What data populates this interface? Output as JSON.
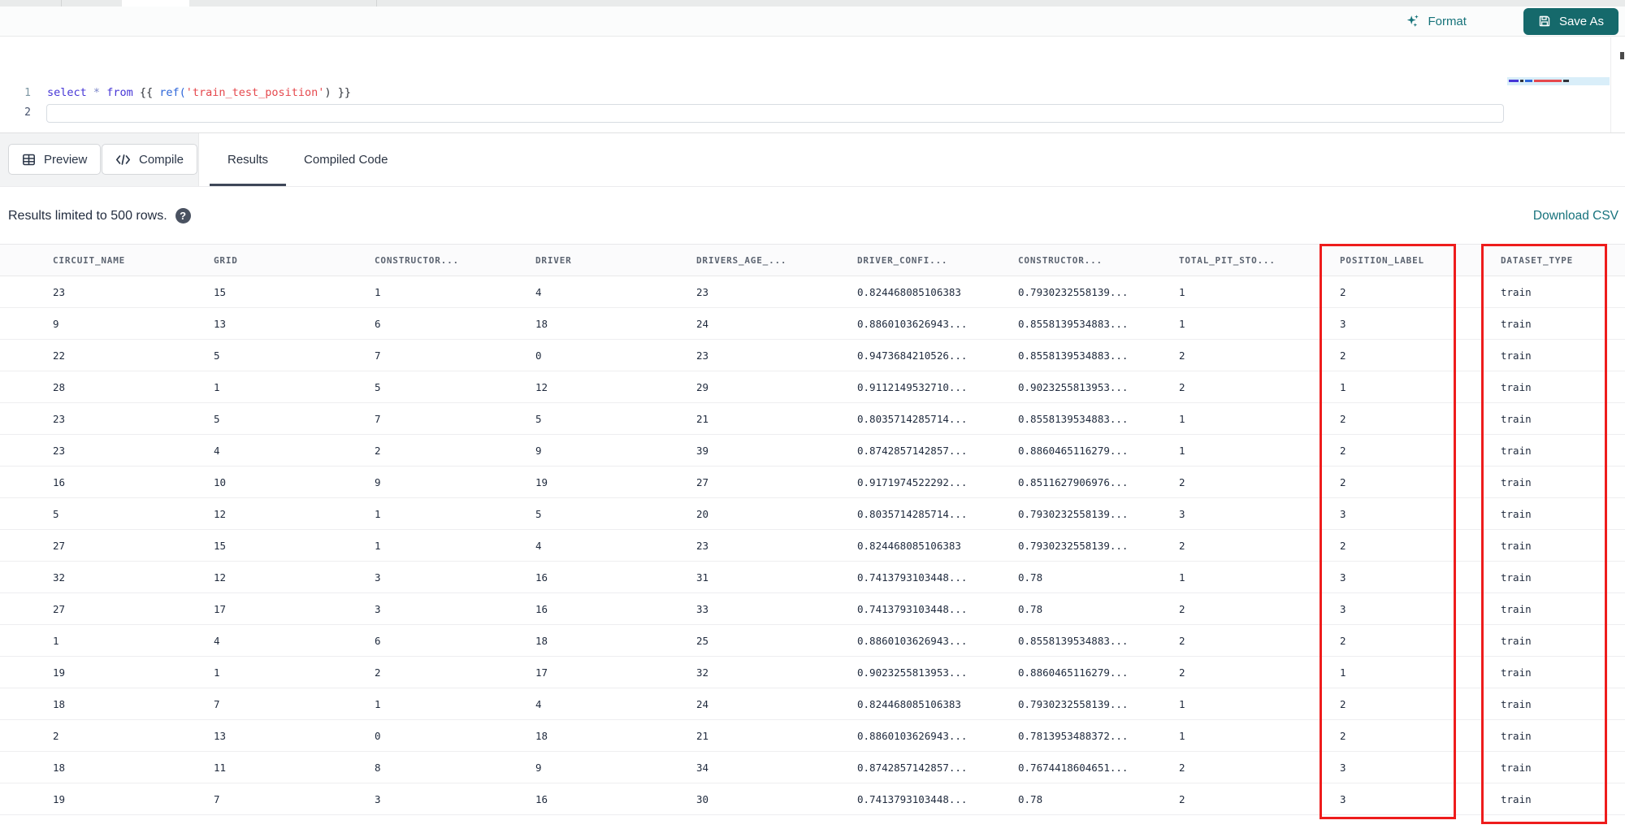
{
  "topbar": {
    "format_label": "Format",
    "save_as_label": "Save As"
  },
  "editor": {
    "line_numbers": [
      "1",
      "2"
    ],
    "code_text": "select * from {{ ref('train_test_position') }}",
    "code_tokens": [
      {
        "text": "select",
        "type": "keyword"
      },
      {
        "text": " ",
        "type": "brace"
      },
      {
        "text": "*",
        "type": "operator"
      },
      {
        "text": " ",
        "type": "brace"
      },
      {
        "text": "from",
        "type": "keyword"
      },
      {
        "text": " {{ ",
        "type": "brace"
      },
      {
        "text": "ref(",
        "type": "function"
      },
      {
        "text": "'train_test_position'",
        "type": "string"
      },
      {
        "text": ")",
        "type": "brace"
      },
      {
        "text": " }}",
        "type": "brace"
      }
    ]
  },
  "actionbar": {
    "preview_label": "Preview",
    "compile_label": "Compile",
    "tabs": [
      {
        "label": "Results",
        "active": true
      },
      {
        "label": "Compiled Code",
        "active": false
      }
    ]
  },
  "results": {
    "limit_note": "Results limited to 500 rows.",
    "help_glyph": "?",
    "download_label": "Download CSV",
    "table": {
      "columns": [
        "CIRCUIT_NAME",
        "GRID",
        "CONSTRUCTOR...",
        "DRIVER",
        "DRIVERS_AGE_...",
        "DRIVER_CONFI...",
        "CONSTRUCTOR...",
        "TOTAL_PIT_STO...",
        "POSITION_LABEL",
        "DATASET_TYPE"
      ],
      "rows": [
        [
          "23",
          "15",
          "1",
          "4",
          "23",
          "0.824468085106383",
          "0.7930232558139...",
          "1",
          "2",
          "train"
        ],
        [
          "9",
          "13",
          "6",
          "18",
          "24",
          "0.8860103626943...",
          "0.8558139534883...",
          "1",
          "3",
          "train"
        ],
        [
          "22",
          "5",
          "7",
          "0",
          "23",
          "0.9473684210526...",
          "0.8558139534883...",
          "2",
          "2",
          "train"
        ],
        [
          "28",
          "1",
          "5",
          "12",
          "29",
          "0.9112149532710...",
          "0.9023255813953...",
          "2",
          "1",
          "train"
        ],
        [
          "23",
          "5",
          "7",
          "5",
          "21",
          "0.8035714285714...",
          "0.8558139534883...",
          "1",
          "2",
          "train"
        ],
        [
          "23",
          "4",
          "2",
          "9",
          "39",
          "0.8742857142857...",
          "0.8860465116279...",
          "1",
          "2",
          "train"
        ],
        [
          "16",
          "10",
          "9",
          "19",
          "27",
          "0.9171974522292...",
          "0.8511627906976...",
          "2",
          "2",
          "train"
        ],
        [
          "5",
          "12",
          "1",
          "5",
          "20",
          "0.8035714285714...",
          "0.7930232558139...",
          "3",
          "3",
          "train"
        ],
        [
          "27",
          "15",
          "1",
          "4",
          "23",
          "0.824468085106383",
          "0.7930232558139...",
          "2",
          "2",
          "train"
        ],
        [
          "32",
          "12",
          "3",
          "16",
          "31",
          "0.7413793103448...",
          "0.78",
          "1",
          "3",
          "train"
        ],
        [
          "27",
          "17",
          "3",
          "16",
          "33",
          "0.7413793103448...",
          "0.78",
          "2",
          "3",
          "train"
        ],
        [
          "1",
          "4",
          "6",
          "18",
          "25",
          "0.8860103626943...",
          "0.8558139534883...",
          "2",
          "2",
          "train"
        ],
        [
          "19",
          "1",
          "2",
          "17",
          "32",
          "0.9023255813953...",
          "0.8860465116279...",
          "2",
          "1",
          "train"
        ],
        [
          "18",
          "7",
          "1",
          "4",
          "24",
          "0.824468085106383",
          "0.7930232558139...",
          "1",
          "2",
          "train"
        ],
        [
          "2",
          "13",
          "0",
          "18",
          "21",
          "0.8860103626943...",
          "0.7813953488372...",
          "1",
          "2",
          "train"
        ],
        [
          "18",
          "11",
          "8",
          "9",
          "34",
          "0.8742857142857...",
          "0.7674418604651...",
          "2",
          "3",
          "train"
        ],
        [
          "19",
          "7",
          "3",
          "16",
          "30",
          "0.7413793103448...",
          "0.78",
          "2",
          "3",
          "train"
        ]
      ],
      "highlighted_columns": [
        "POSITION_LABEL",
        "DATASET_TYPE"
      ]
    }
  },
  "colors": {
    "accent_teal": "#15696b",
    "link_teal": "#17737d",
    "highlight_red": "#ee1c1c"
  }
}
